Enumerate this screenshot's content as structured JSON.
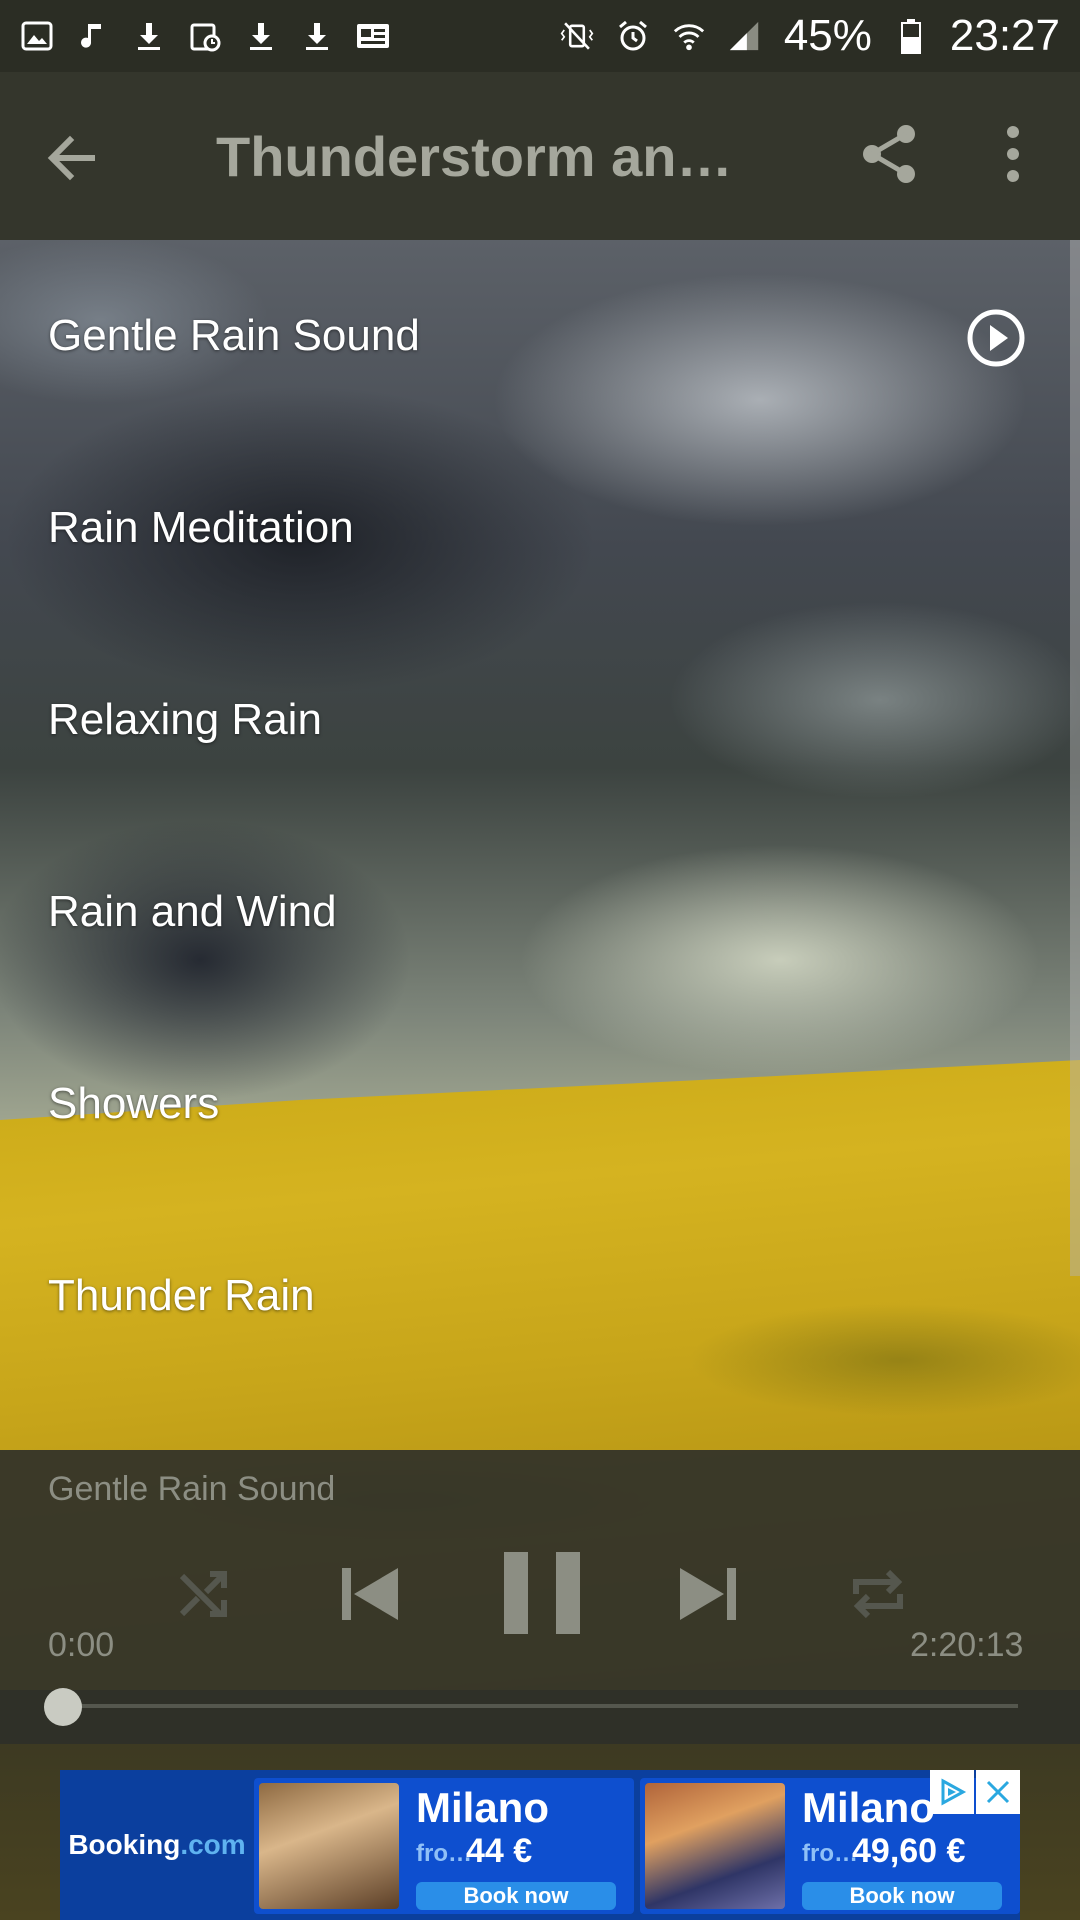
{
  "status_bar": {
    "battery": "45%",
    "time": "23:27",
    "left_icons": [
      "gallery-icon",
      "music-note-icon",
      "download-icon",
      "calendar-icon",
      "download-icon",
      "download-icon",
      "news-icon"
    ],
    "right_icons": [
      "vibrate-mute-icon",
      "alarm-icon",
      "wifi-icon",
      "signal-icon",
      "battery-icon"
    ]
  },
  "app_bar": {
    "title": "Thunderstorm and…",
    "back_icon": "arrow-back-icon",
    "share_icon": "share-icon",
    "more_icon": "more-vert-icon"
  },
  "tracks": [
    {
      "label": "Gentle Rain Sound",
      "playing": true
    },
    {
      "label": "Rain Meditation",
      "playing": false
    },
    {
      "label": "Relaxing Rain",
      "playing": false
    },
    {
      "label": "Rain and Wind",
      "playing": false
    },
    {
      "label": "Showers",
      "playing": false
    },
    {
      "label": "Thunder Rain",
      "playing": false
    }
  ],
  "player": {
    "now_playing": "Gentle Rain Sound",
    "current_time": "0:00",
    "total_time": "2:20:13",
    "progress": 0.0,
    "controls": [
      "shuffle-icon",
      "skip-previous-icon",
      "pause-icon",
      "skip-next-icon",
      "repeat-icon"
    ]
  },
  "ad": {
    "brand_main": "Booking",
    "brand_suffix": ".com",
    "offers": [
      {
        "city": "Milano",
        "from": "fro…",
        "price": "44 €",
        "button": "Book now"
      },
      {
        "city": "Milano",
        "from": "fro…",
        "price": "49,60 €",
        "button": "Book now"
      }
    ]
  },
  "colors": {
    "status_bar": "#2b2d24",
    "app_bar": "#34362c",
    "title_text": "#a5a79c",
    "player_bg": "#30322a",
    "ad_blue": "#0b3f9e",
    "ad_button": "#2a8ee8"
  }
}
